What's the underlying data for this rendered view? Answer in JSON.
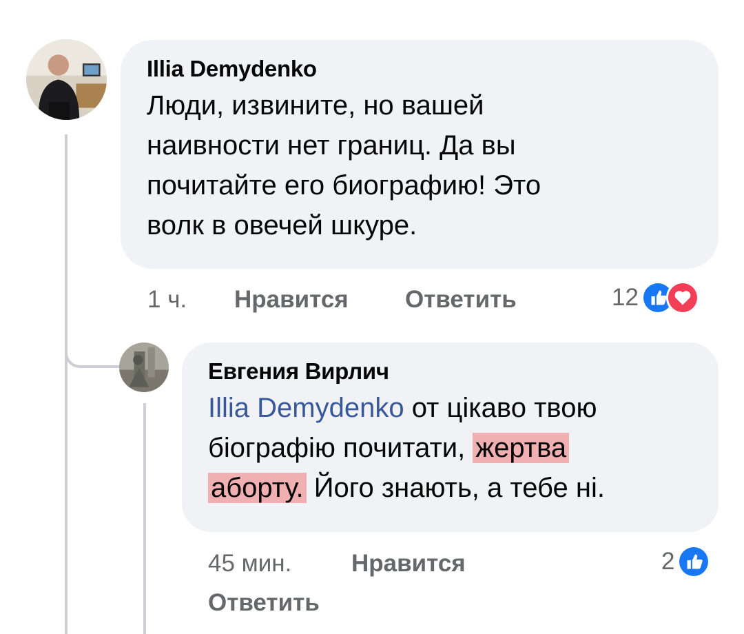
{
  "comment": {
    "author": "Illia Demydenko",
    "lines": [
      "Люди, извините, но вашей",
      "наивности нет границ. Да вы",
      "почитайте его биографию! Это",
      "волк в овечей шкуре."
    ],
    "time": "1 ч.",
    "like_label": "Нравится",
    "reply_label": "Ответить",
    "reaction_count": "12",
    "reactions": [
      "like-icon",
      "love-icon"
    ]
  },
  "reply": {
    "author": "Евгения Вирлич",
    "mention": "Illia Demydenko",
    "line1_rest": " от цікаво твою",
    "line2_plain": "біографію почитати, ",
    "line2_highlight": "жертва",
    "line3_highlight": "аборту.",
    "line3_rest": " Його знають, а тебе ні.",
    "time": "45 мин.",
    "like_label": "Нравится",
    "reply_label": "Ответить",
    "reaction_count": "2",
    "reactions": [
      "like-icon"
    ]
  },
  "colors": {
    "bubble": "#f0f2f5",
    "mention": "#385898",
    "meta": "#65676b",
    "like": "#1877f2",
    "love": "#f33e58",
    "highlight": "#f07878"
  }
}
